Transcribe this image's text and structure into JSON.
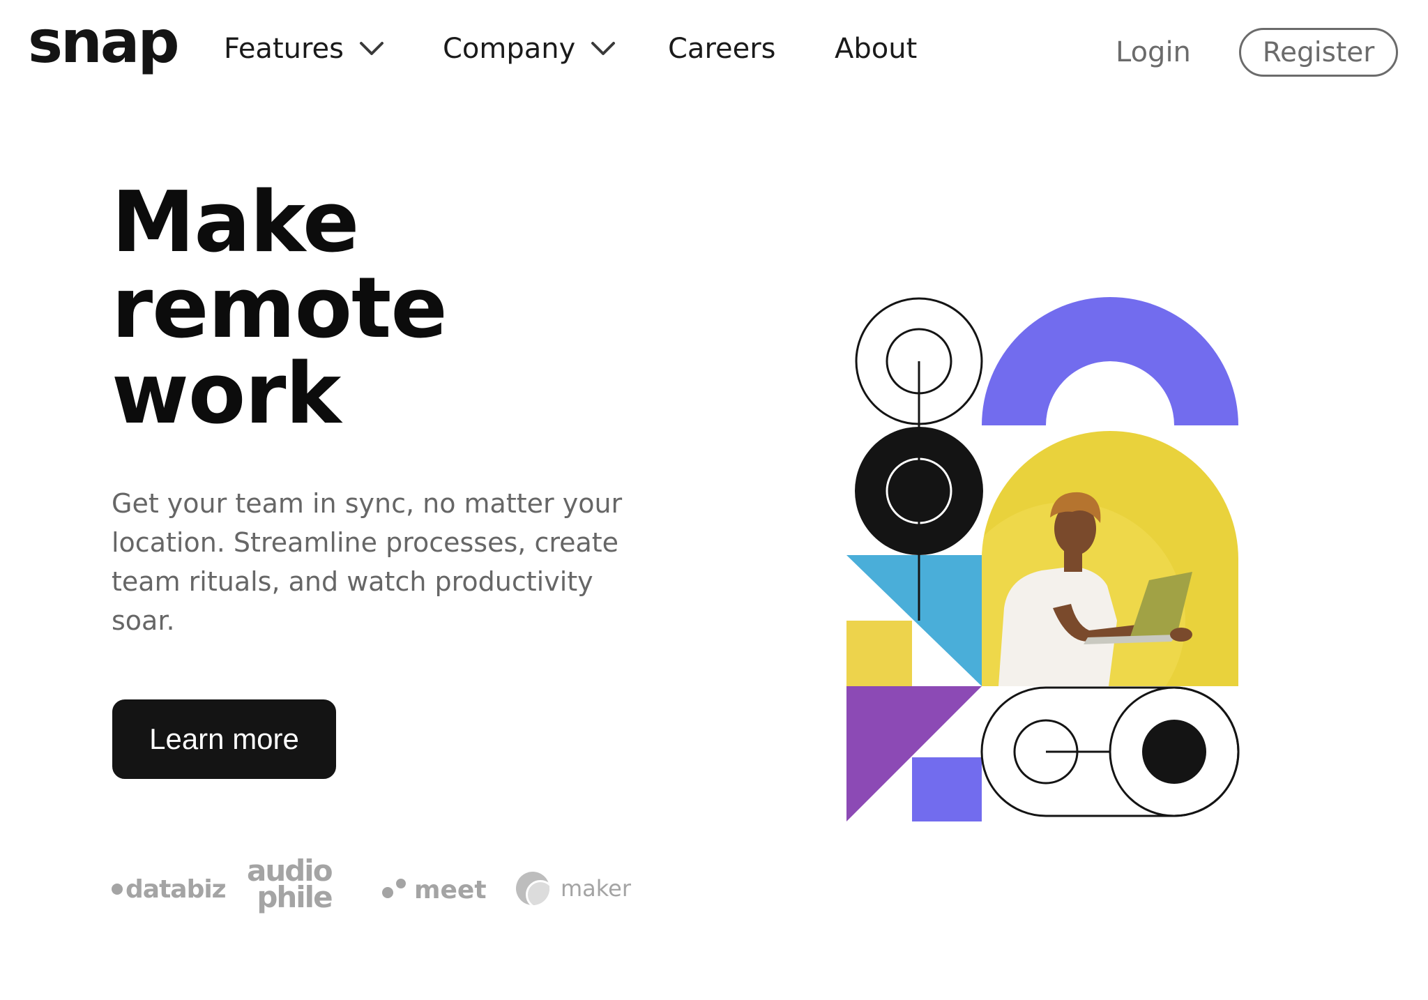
{
  "header": {
    "logo": "snap",
    "nav": [
      {
        "label": "Features",
        "has_dropdown": true,
        "icon": "chevron-down-icon"
      },
      {
        "label": "Company",
        "has_dropdown": true,
        "icon": "chevron-down-icon"
      },
      {
        "label": "Careers",
        "has_dropdown": false
      },
      {
        "label": "About",
        "has_dropdown": false
      }
    ],
    "login_label": "Login",
    "register_label": "Register"
  },
  "hero": {
    "title_lines": [
      "Make",
      "remote",
      "work"
    ],
    "description": "Get your team in sync, no matter your location. Streamline processes, create team rituals, and watch productivity soar.",
    "cta_label": "Learn more"
  },
  "clients": {
    "databiz": "databiz",
    "audiophile_top": "audio",
    "audiophile_bottom": "phile",
    "meet": "meet",
    "maker": "maker"
  },
  "colors": {
    "text_dark": "#141414",
    "text_grey": "#666666",
    "client_grey": "#a4a4a4",
    "purple": "#726cee",
    "violet": "#8c4ab5",
    "blue": "#4aaed9",
    "yellow": "#edd34c",
    "photo_yellow": "#e9d23c"
  }
}
